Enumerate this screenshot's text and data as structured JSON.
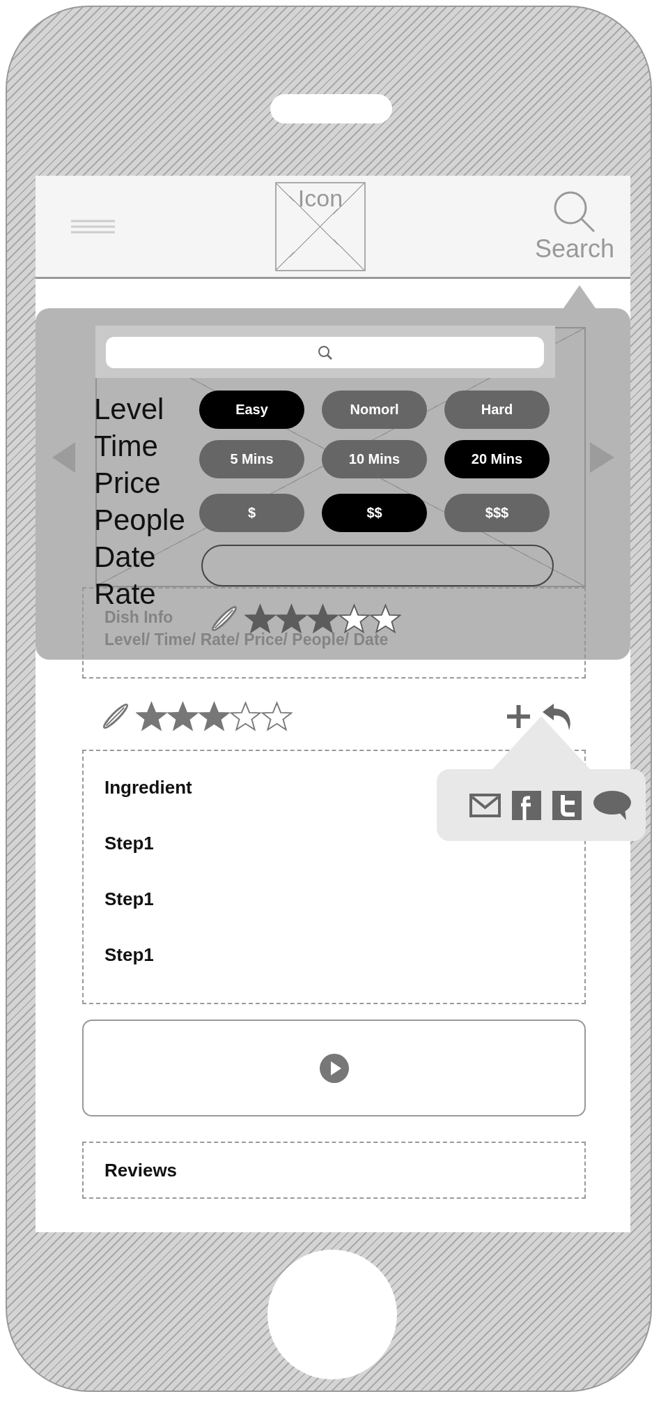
{
  "header": {
    "logo_text": "Icon",
    "search_label": "Search"
  },
  "dish": {
    "info_title": "Dish Info",
    "info_fields": "Level/ Time/ Rate/ Price/ People/ Date"
  },
  "filter_panel": {
    "labels": [
      "Level",
      "Time",
      "Price",
      "People",
      "Date",
      "Rate"
    ],
    "option_groups": [
      {
        "options": [
          {
            "label": "Easy",
            "selected": true
          },
          {
            "label": "Nomorl",
            "selected": false
          },
          {
            "label": "Hard",
            "selected": false
          }
        ]
      },
      {
        "options": [
          {
            "label": "5 Mins",
            "selected": false
          },
          {
            "label": "10 Mins",
            "selected": false
          },
          {
            "label": "20 Mins",
            "selected": true
          }
        ]
      },
      {
        "options": [
          {
            "label": "$",
            "selected": false
          },
          {
            "label": "$$",
            "selected": true
          },
          {
            "label": "$$$",
            "selected": false
          }
        ]
      }
    ],
    "rating": {
      "stars": 3
    }
  },
  "rating": {
    "stars": 3
  },
  "sections": [
    {
      "text": "Ingredient"
    },
    {
      "text": "Step1"
    },
    {
      "text": "Step1"
    },
    {
      "text": "Step1"
    }
  ],
  "reviews": {
    "title": "Reviews"
  }
}
